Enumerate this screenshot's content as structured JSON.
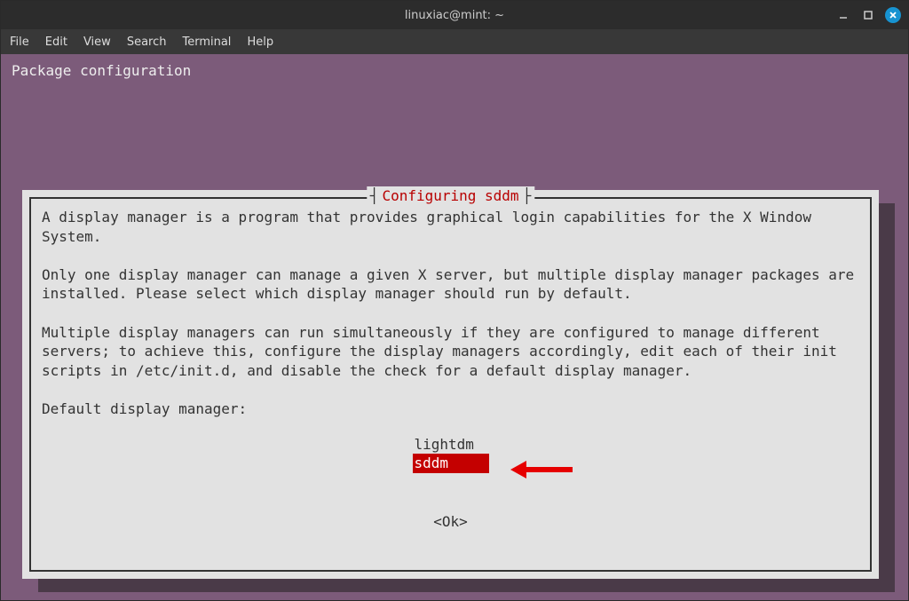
{
  "window": {
    "title": "linuxiac@mint: ~"
  },
  "menubar": {
    "file": "File",
    "edit": "Edit",
    "view": "View",
    "search": "Search",
    "terminal": "Terminal",
    "help": "Help"
  },
  "terminal": {
    "header": "Package configuration",
    "dialog": {
      "title": "Configuring sddm",
      "body_line1": "A display manager is a program that provides graphical login capabilities for the X Window System.",
      "body_line2": "Only one display manager can manage a given X server, but multiple display manager packages are installed. Please select which display manager should run by default.",
      "body_line3": "Multiple display managers can run simultaneously if they are configured to manage different servers; to achieve this, configure the display managers accordingly, edit each of their init scripts in /etc/init.d, and disable the check for a default display manager.",
      "prompt": "Default display manager:",
      "options": {
        "opt1": "lightdm",
        "opt2": "sddm"
      },
      "ok": "<Ok>"
    }
  }
}
